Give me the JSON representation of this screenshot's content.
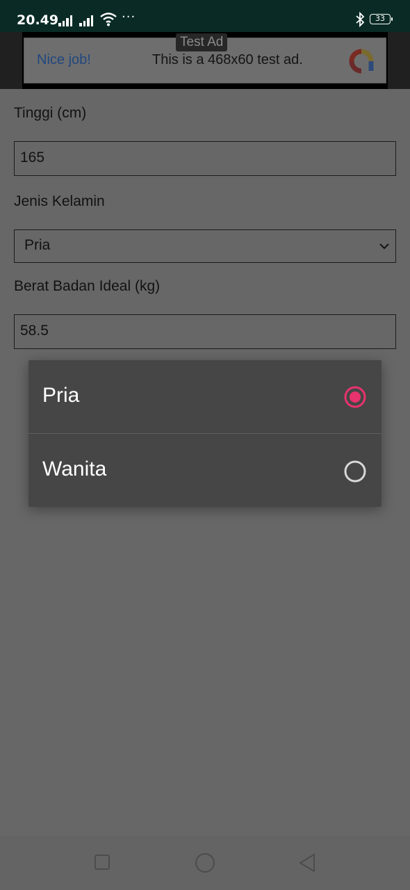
{
  "status_bar": {
    "time": "20.49",
    "battery": "33",
    "overflow": "···",
    "icons": [
      "signal-icon",
      "signal-icon",
      "wifi-icon",
      "bluetooth-icon",
      "battery-icon"
    ]
  },
  "ad": {
    "badge": "Test Ad",
    "headline": "Nice job!",
    "body": "This is a 468x60 test ad.",
    "logo": "ad-logo-icon"
  },
  "form": {
    "height_label": "Tinggi (cm)",
    "height_value": "165",
    "gender_label": "Jenis Kelamin",
    "gender_value": "Pria",
    "ideal_weight_label": "Berat Badan Ideal (kg)",
    "ideal_weight_value": "58.5"
  },
  "gender_dialog": {
    "options": [
      {
        "label": "Pria",
        "selected": true
      },
      {
        "label": "Wanita",
        "selected": false
      }
    ],
    "accent_color": "#e8336e"
  },
  "nav_bar": {
    "buttons": [
      "recents-square-icon",
      "home-circle-icon",
      "back-triangle-icon"
    ]
  }
}
